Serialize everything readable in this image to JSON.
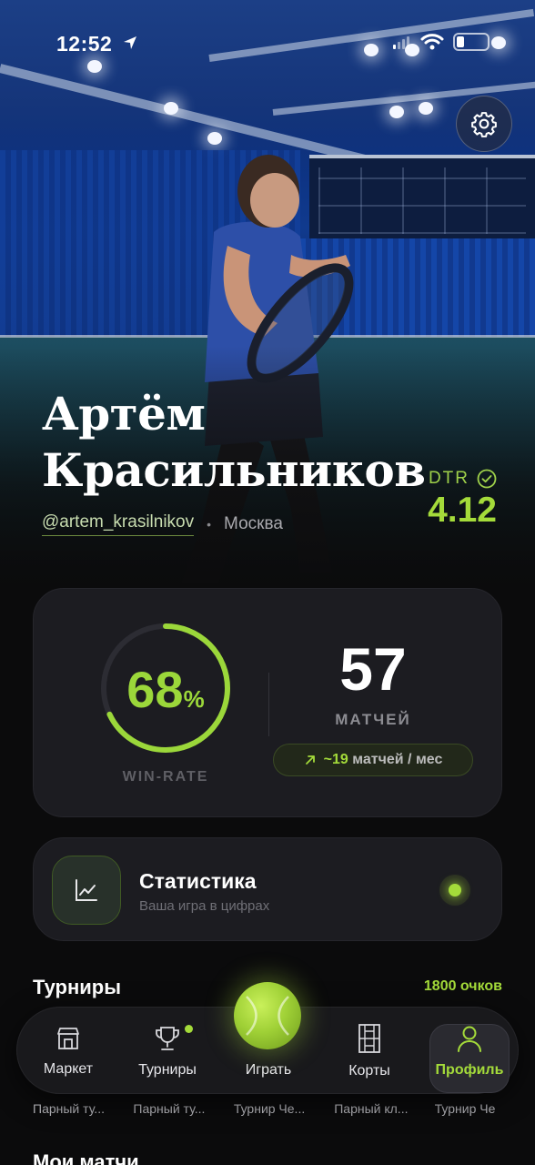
{
  "status_bar": {
    "time": "12:52"
  },
  "profile": {
    "name_line1": "Артём",
    "name_line2": "Красильников",
    "handle": "@artem_krasilnikov",
    "separator": "•",
    "city": "Москва",
    "dtr_label": "DTR",
    "dtr_value": "4.12"
  },
  "stats": {
    "win_rate_value": "68",
    "win_rate_unit": "%",
    "win_rate_fraction": 0.68,
    "win_rate_label": "WIN-RATE",
    "matches_count": "57",
    "matches_label": "МАТЧЕЙ",
    "pace_value": "~19",
    "pace_suffix": "матчей / мес"
  },
  "statistics_card": {
    "title": "Статистика",
    "subtitle": "Ваша игра в цифрах"
  },
  "tournaments": {
    "title": "Турниры",
    "points": "1800 очков",
    "items": [
      "Парный ту...",
      "Парный ту...",
      "Турнир Че...",
      "Парный кл...",
      "Турнир Че"
    ]
  },
  "next_section": {
    "title": "Мои матчи"
  },
  "tabbar": {
    "items": [
      {
        "label": "Маркет",
        "icon": "store-icon"
      },
      {
        "label": "Турниры",
        "icon": "trophy-icon"
      },
      {
        "label": "Играть",
        "icon": "tennis-ball-icon"
      },
      {
        "label": "Корты",
        "icon": "court-icon"
      },
      {
        "label": "Профиль",
        "icon": "user-icon"
      }
    ],
    "active": "Профиль"
  },
  "colors": {
    "accent": "#a4db3a",
    "background": "#0b0b0c",
    "card": "#1c1c21"
  }
}
